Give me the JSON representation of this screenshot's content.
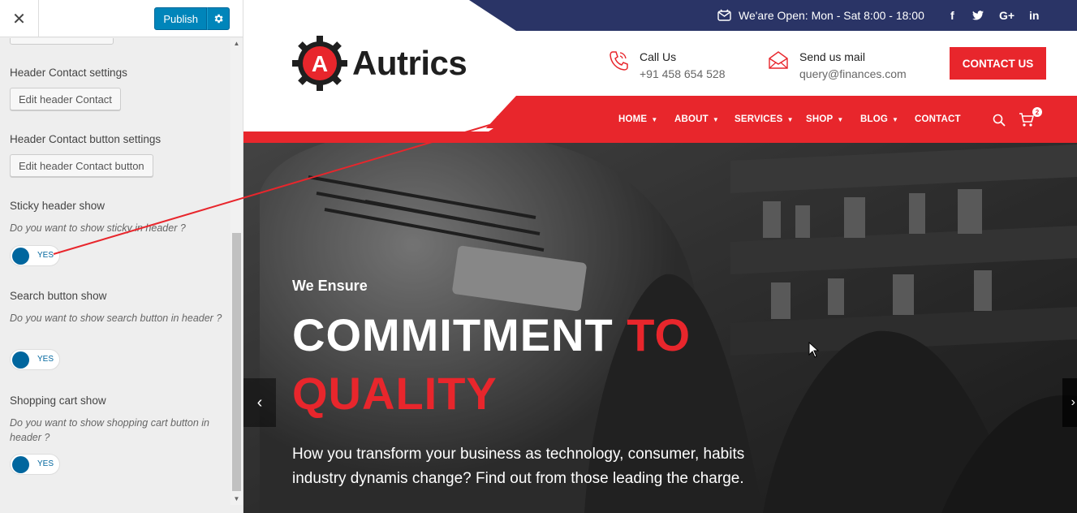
{
  "sidebar": {
    "close_label": "✕",
    "publish_label": "Publish",
    "sections": {
      "header_contact": {
        "title": "Header Contact settings",
        "button": "Edit header Contact"
      },
      "header_contact_button": {
        "title": "Header Contact button settings",
        "button": "Edit header Contact button"
      },
      "sticky_header": {
        "title": "Sticky header show",
        "desc": "Do you want to show sticky in header ?",
        "toggle": "YES"
      },
      "search_button": {
        "title": "Search button show",
        "desc": "Do you want to show search button in header ?",
        "toggle": "YES"
      },
      "shopping_cart": {
        "title": "Shopping cart show",
        "desc": "Do you want to show shopping cart button in header ?",
        "toggle": "YES"
      }
    }
  },
  "site": {
    "topbar": {
      "hours": "We'are Open: Mon - Sat 8:00 - 18:00",
      "social": [
        "f",
        "t",
        "G+",
        "in"
      ]
    },
    "logo": {
      "text": "Autrics",
      "letter": "A"
    },
    "call": {
      "title": "Call Us",
      "value": "+91 458 654 528"
    },
    "mail": {
      "title": "Send us mail",
      "value": "query@finances.com"
    },
    "contact_button": "CONTACT US",
    "nav": [
      {
        "label": "HOME",
        "dropdown": true
      },
      {
        "label": "ABOUT",
        "dropdown": true
      },
      {
        "label": "SERVICES",
        "dropdown": true
      },
      {
        "label": "SHOP",
        "dropdown": true
      },
      {
        "label": "BLOG",
        "dropdown": true
      },
      {
        "label": "CONTACT",
        "dropdown": false
      }
    ],
    "cart_count": "2",
    "hero": {
      "kicker": "We Ensure",
      "line1_white": "COMMITMENT ",
      "line1_red": "TO",
      "line2": "QUALITY",
      "desc": "How you transform your business as technology, consumer, habits industry dynamis change? Find out from those leading the charge.",
      "prev": "‹",
      "next": "›"
    }
  },
  "colors": {
    "brand_red": "#e8262c",
    "topbar_navy": "#2a3466",
    "wp_blue": "#0085ba",
    "toggle_blue": "#00669e"
  }
}
